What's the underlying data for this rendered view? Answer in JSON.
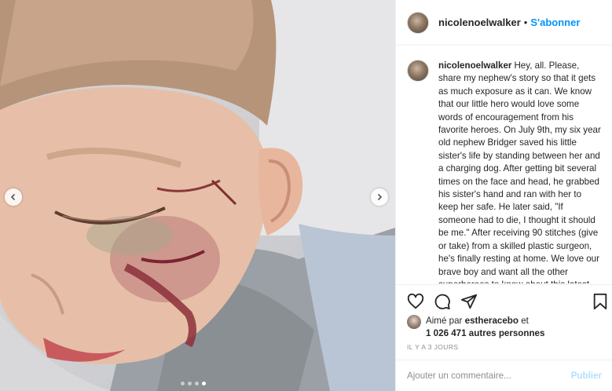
{
  "post": {
    "photo_alt": "",
    "carousel": {
      "count": 4,
      "active_index": 3
    }
  },
  "header": {
    "username": "nicolenoelwalker",
    "separator": "•",
    "follow_label": "S'abonner"
  },
  "caption": {
    "username": "nicolenoelwalker",
    "text": "Hey, all. Please, share my nephew's story so that it gets as much exposure as it can. We know that our little hero would love some words of encouragement from his favorite heroes. On July 9th, my six year old nephew Bridger saved his little sister's life by standing between her and a charging dog. After getting bit several times on the face and head, he grabbed his sister's hand and ran with her to keep her safe. He later said, \"If someone had to die, I thought it should be me.\" After receiving 90 stitches (give or take) from a skilled plastic surgeon, he's finally resting at home. We love our brave boy and want all the other superheroes to know about this latest hero who"
  },
  "actions": {
    "like": "heart-icon",
    "comment": "comment-icon",
    "share": "share-icon",
    "save": "bookmark-icon"
  },
  "likes": {
    "prefix": "Aimé par",
    "user": "estheracebo",
    "conj": "et",
    "count": "1 026 471 autres personnes"
  },
  "timestamp": "IL Y A 3 JOURS",
  "comment": {
    "placeholder": "Ajouter un commentaire...",
    "publish_label": "Publier"
  },
  "colors": {
    "accent": "#0095f6",
    "publish_disabled": "#b2dffc",
    "muted": "#8e8e8e",
    "border": "#efefef"
  }
}
